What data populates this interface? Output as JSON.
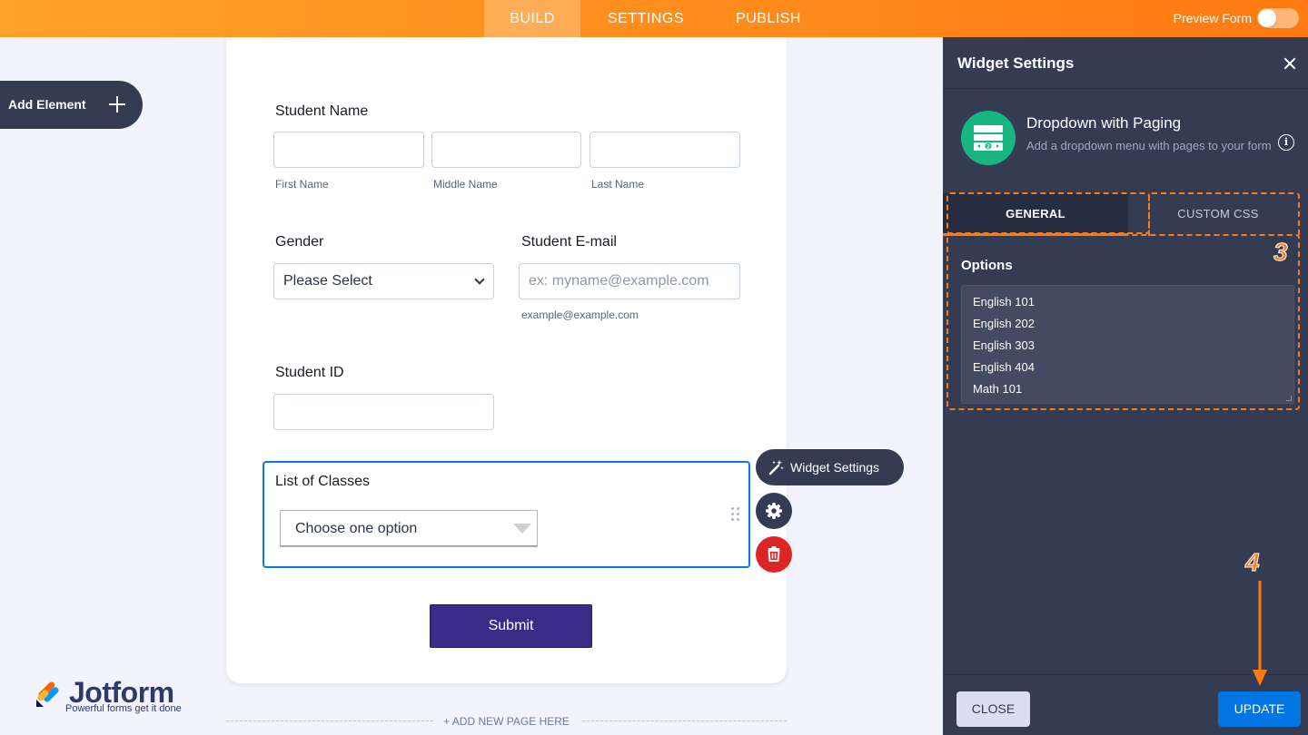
{
  "topbar": {
    "tabs": [
      {
        "label": "BUILD"
      },
      {
        "label": "SETTINGS"
      },
      {
        "label": "PUBLISH"
      }
    ],
    "active_tab": "BUILD",
    "preview_label": "Preview Form",
    "preview_on": false
  },
  "add_element": {
    "label": "Add Element"
  },
  "form": {
    "student_name": {
      "label": "Student Name",
      "sublabels": [
        "First Name",
        "Middle Name",
        "Last Name"
      ]
    },
    "gender": {
      "label": "Gender",
      "selected": "Please Select"
    },
    "email": {
      "label": "Student E-mail",
      "placeholder": "ex: myname@example.com",
      "sublabel": "example@example.com"
    },
    "student_id": {
      "label": "Student ID"
    },
    "classes": {
      "label": "List of Classes",
      "selected": "Choose one option"
    },
    "submit_label": "Submit",
    "add_page_label": "+ ADD NEW PAGE HERE"
  },
  "field_toolbar": {
    "widget_settings_label": "Widget Settings"
  },
  "logo": {
    "name": "Jotform",
    "tagline": "Powerful forms get it done"
  },
  "panel": {
    "title": "Widget Settings",
    "widget_name": "Dropdown with Paging",
    "widget_description": "Add a dropdown menu with pages to your form",
    "tabs": [
      {
        "label": "GENERAL"
      },
      {
        "label": "CUSTOM CSS"
      }
    ],
    "active_tab": "GENERAL",
    "options_label": "Options",
    "options": [
      "English 101",
      "English 202",
      "English 303",
      "English 404",
      "Math 101"
    ],
    "close_label": "CLOSE",
    "update_label": "UPDATE"
  },
  "annotations": {
    "step3": "3",
    "step4": "4"
  },
  "colors": {
    "accent": "#ff7a10",
    "panel_bg": "#343c54",
    "update_blue": "#0075e3",
    "delete_red": "#dc2626",
    "widget_green": "#18b580"
  }
}
